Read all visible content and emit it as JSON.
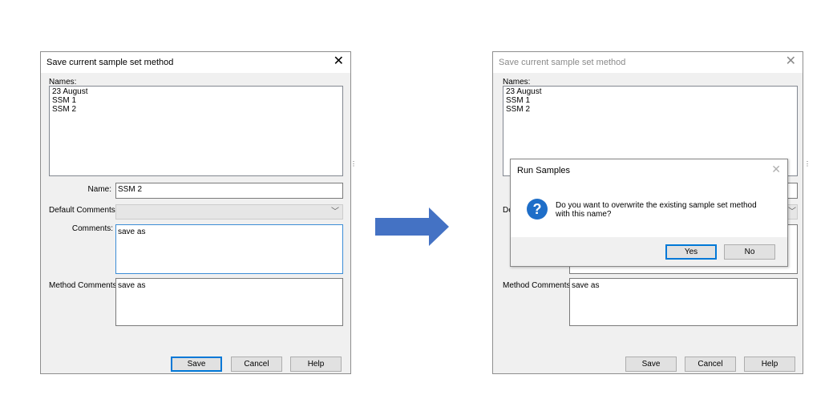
{
  "left_dialog": {
    "title": "Save current sample set method",
    "close_glyph": "✕",
    "names_label": "Names:",
    "names": [
      "23 August",
      "SSM 1",
      "SSM 2"
    ],
    "name_label": "Name:",
    "name_value": "SSM 2",
    "default_comments_label": "Default Comments:",
    "default_comments_value": "",
    "comments_label": "Comments:",
    "comments_value": "save as",
    "method_comments_label": "Method Comments:",
    "method_comments_value": "save as",
    "buttons": {
      "save": "Save",
      "cancel": "Cancel",
      "help": "Help"
    }
  },
  "right_dialog": {
    "title": "Save current sample set method",
    "close_glyph": "✕",
    "names_label": "Names:",
    "names": [
      "23 August",
      "SSM 1",
      "SSM 2"
    ],
    "default_comments_label_partial": "De",
    "method_comments_label": "Method Comments:",
    "method_comments_value": "save as",
    "buttons": {
      "save": "Save",
      "cancel": "Cancel",
      "help": "Help"
    }
  },
  "message_box": {
    "title": "Run Samples",
    "close_glyph": "✕",
    "icon": "question-icon",
    "icon_glyph": "?",
    "message_line1": "Do you want to overwrite the existing sample set method",
    "message_line2": "with this name?",
    "yes_label": "Yes",
    "no_label": "No"
  },
  "arrow_color": "#4472c4"
}
